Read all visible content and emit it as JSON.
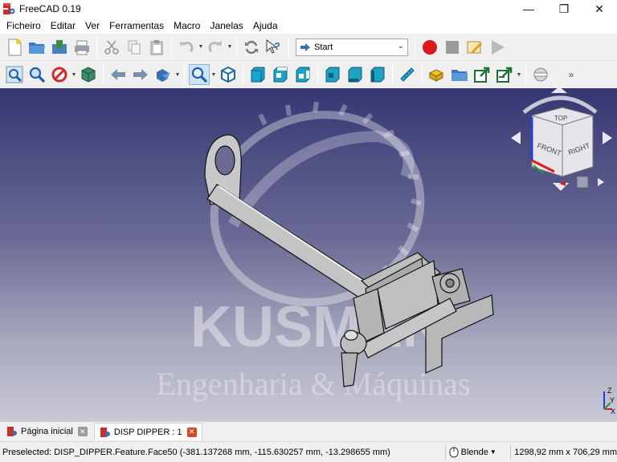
{
  "window": {
    "title": "FreeCAD 0.19",
    "minimize_glyph": "—",
    "maximize_glyph": "❐",
    "close_glyph": "✕"
  },
  "menu": [
    "Ficheiro",
    "Editar",
    "Ver",
    "Ferramentas",
    "Macro",
    "Janelas",
    "Ajuda"
  ],
  "toolbar": {
    "workbench_selector": "Start",
    "overflow_glyph": "»"
  },
  "viewport": {
    "watermark_title": "KUSMAN",
    "watermark_subtitle": "Engenharia & Máquinas",
    "navcube_faces": [
      "FRONT",
      "RIGHT",
      "TOP"
    ],
    "axis_labels": [
      "Z",
      "Y",
      "X"
    ]
  },
  "tabs": [
    {
      "label": "Página inicial",
      "active": false
    },
    {
      "label": "DISP DIPPER : 1",
      "active": true
    }
  ],
  "status": {
    "preselected": "Preselected: DISP_DIPPER.Feature.Face50 (-381.137268 mm, -115.630257 mm, -13.298655 mm)",
    "navigation_style": "Blende",
    "dimensions": "1298,92 mm x 706,29 mm"
  },
  "colors": {
    "viewport_top": "#353773",
    "viewport_bottom": "#c9c9d6",
    "record_red": "#d9191f",
    "freecad_red": "#c9302c",
    "navcube_arrow": "#e8e8ee"
  }
}
